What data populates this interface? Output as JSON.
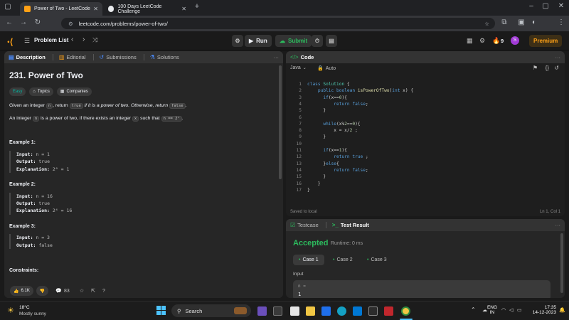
{
  "browser": {
    "tabs": [
      {
        "label": "Power of Two - LeetCode",
        "active": true
      },
      {
        "label": "100 Days LeetCode Challenge",
        "active": false
      }
    ],
    "url": "leetcode.com/problems/power-of-two/"
  },
  "header": {
    "problem_list": "Problem List",
    "run": "Run",
    "submit": "Submit",
    "streak": "9",
    "avatar": "S",
    "premium": "Premium"
  },
  "desc_panel": {
    "tabs": [
      "Description",
      "Editorial",
      "Submissions",
      "Solutions"
    ],
    "title": "231. Power of Two",
    "tags": [
      "Easy",
      "Topics",
      "Companies"
    ],
    "p1": {
      "a": "Given an integer",
      "n": "n",
      "b": ", return",
      "t": "true",
      "c": "if it is a power of two. Otherwise, return",
      "f": "false",
      "d": "."
    },
    "p2": {
      "a": "An integer",
      "n": "n",
      "b": "is a power of two, if there exists an integer",
      "x": "x",
      "c": "such that",
      "eq": "n == 2ˣ",
      "d": "."
    },
    "examples": [
      {
        "heading": "Example 1:",
        "input": "n = 1",
        "output": "true",
        "explanation": "2⁰ = 1"
      },
      {
        "heading": "Example 2:",
        "input": "n = 16",
        "output": "true",
        "explanation": "2⁴ = 16"
      },
      {
        "heading": "Example 3:",
        "input": "n = 3",
        "output": "false"
      }
    ],
    "labels": {
      "input": "Input:",
      "output": "Output:",
      "explanation": "Explanation:"
    },
    "constraints": "Constraints:",
    "likes": "6.1K",
    "comments": "83"
  },
  "code_panel": {
    "title": "Code",
    "language": "Java",
    "mode": "Auto",
    "lines": [
      "class Solution {",
      "    public boolean isPowerOfTwo(int x) {",
      "      if(x==0){",
      "          return false;",
      "      }",
      "",
      "      while(x%2==0){",
      "          x = x/2 ;",
      "      }",
      "",
      "      if(x==1){",
      "          return true ;",
      "      }else{",
      "          return false;",
      "      }",
      "    }",
      "}"
    ],
    "status_left": "Saved to local",
    "status_right": "Ln 1, Col 1"
  },
  "test_panel": {
    "tabs": [
      "Testcase",
      "Test Result"
    ],
    "verdict": "Accepted",
    "runtime": "Runtime: 0 ms",
    "cases": [
      "Case 1",
      "Case 2",
      "Case 3"
    ],
    "input_label": "Input",
    "var_name": "n =",
    "var_value": "1"
  },
  "taskbar": {
    "weather_temp": "18°C",
    "weather_desc": "Mostly sunny",
    "search": "Search",
    "lang": "ENG",
    "region": "IN",
    "time": "17:35",
    "date": "14-12-2023"
  },
  "colors": {
    "accepted": "#2cbb5d",
    "easy": "#00b8a3",
    "premium": "#ffa116",
    "submit": "#2cbb5d"
  }
}
